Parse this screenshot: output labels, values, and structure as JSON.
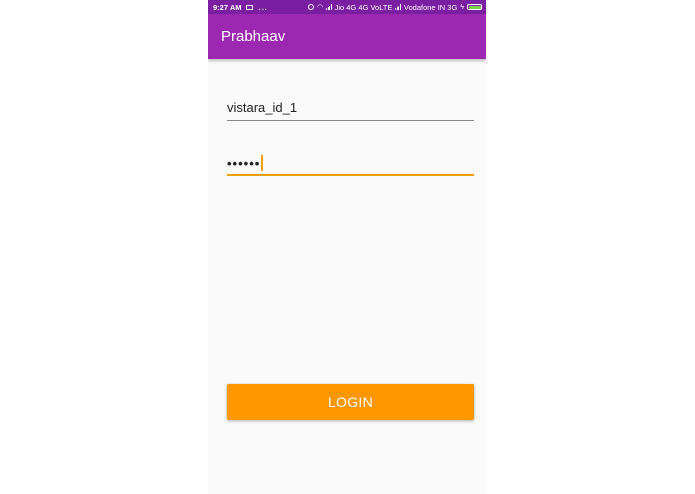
{
  "status_bar": {
    "time": "9:27 AM",
    "dots": "...",
    "carrier1": "Jio 4G 4G VoLTE",
    "carrier2": "Vodafone IN 3G",
    "colors": {
      "background": "#7b1fa2",
      "battery": "#7dd34b"
    }
  },
  "app_bar": {
    "title": "Prabhaav",
    "color": "#9c27b0"
  },
  "login_form": {
    "username_value": "vistara_id_1",
    "password_masked": "••••••",
    "login_button_label": "LOGIN",
    "accent_color": "#ff9800"
  }
}
